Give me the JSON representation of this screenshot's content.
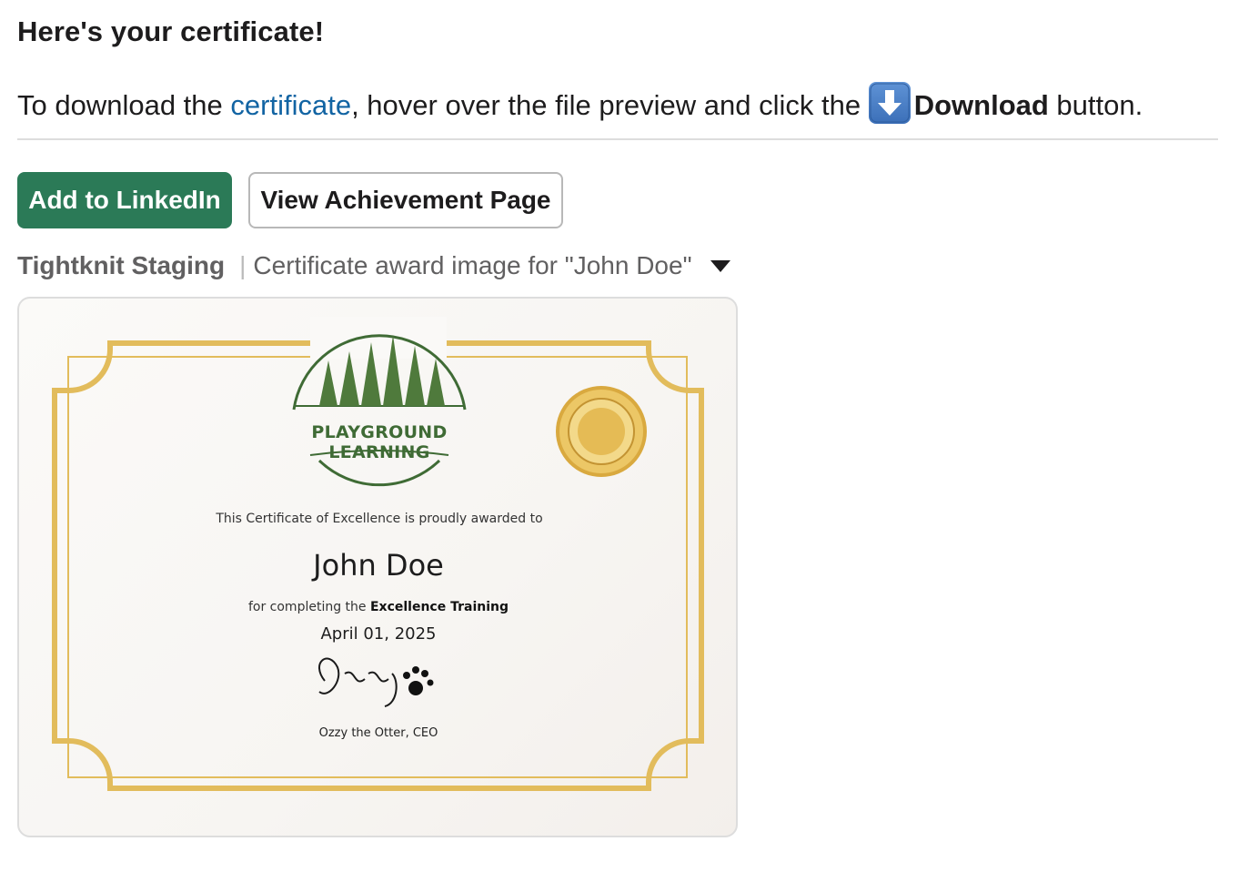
{
  "message": {
    "heading": "Here's your certificate!",
    "instructions": {
      "prefix": "To download the ",
      "link_text": "certificate",
      "middle": ", hover over the file preview and click the ",
      "download_icon": "arrow-down-emoji",
      "bold_text": "Download",
      "suffix": " button."
    }
  },
  "actions": {
    "primary_label": "Add to LinkedIn",
    "secondary_label": "View Achievement Page",
    "primary_color": "#2b7a57"
  },
  "file": {
    "source": "Tightknit Staging",
    "separator": "|",
    "title": "Certificate award image for \"John Doe\""
  },
  "certificate": {
    "organization": "PLAYGROUND LEARNING",
    "award_line": "This Certificate of Excellence is proudly awarded to",
    "recipient": "John Doe",
    "completing_prefix": "for completing the ",
    "course": "Excellence Training",
    "date": "April 01, 2025",
    "signature": "Ozzy",
    "signer": "Ozzy the Otter, CEO",
    "frame_color": "#e2bc5c",
    "logo_color": "#3f6b35"
  }
}
